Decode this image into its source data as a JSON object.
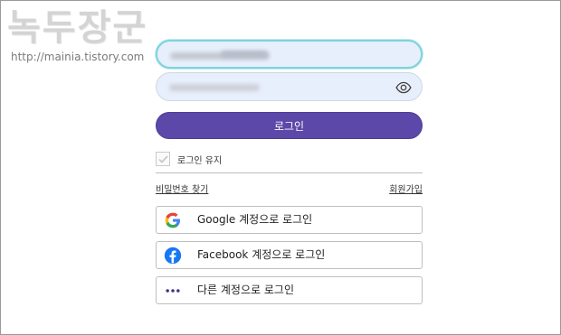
{
  "watermark": {
    "title": "녹두장군",
    "url": "http://mainia.tistory.com"
  },
  "login_form": {
    "id_field_value": "",
    "password_field_value": "",
    "login_button": "로그인",
    "remember_me": {
      "label": "로그인 유지",
      "checked": false
    },
    "find_password_link": "비밀번호 찾기",
    "signup_link": "회원가입"
  },
  "social_buttons": [
    {
      "label": "Google 계정으로 로그인",
      "icon": "google-icon"
    },
    {
      "label": "Facebook 계정으로 로그인",
      "icon": "facebook-icon"
    },
    {
      "label": "다른 계정으로 로그인",
      "icon": "more-dots-icon"
    }
  ],
  "colors": {
    "primary": "#5b48a8",
    "facebook": "#1877f2",
    "input_bg": "#e8effc",
    "focus_ring": "#7fd3dd"
  }
}
